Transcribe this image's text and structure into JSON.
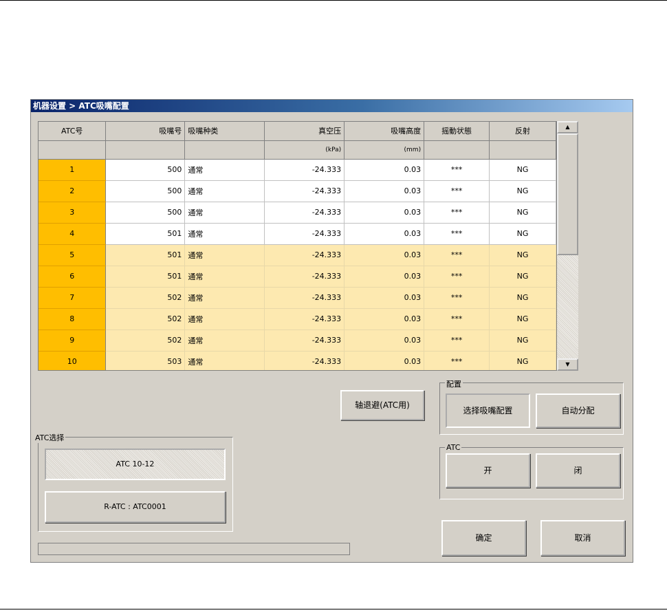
{
  "window": {
    "title": "机器设置 > ATC吸嘴配置"
  },
  "table": {
    "headers": [
      "ATC号",
      "吸嘴号",
      "吸嘴种类",
      "真空压",
      "吸嘴高度",
      "摇動状態",
      "反射"
    ],
    "units": [
      "",
      "",
      "",
      "(kPa)",
      "(mm)",
      "",
      ""
    ],
    "rows": [
      {
        "atc": "1",
        "nozzle": "500",
        "type": "通常",
        "vacuum": "-24.333",
        "height": "0.03",
        "state": "***",
        "reflect": "NG"
      },
      {
        "atc": "2",
        "nozzle": "500",
        "type": "通常",
        "vacuum": "-24.333",
        "height": "0.03",
        "state": "***",
        "reflect": "NG"
      },
      {
        "atc": "3",
        "nozzle": "500",
        "type": "通常",
        "vacuum": "-24.333",
        "height": "0.03",
        "state": "***",
        "reflect": "NG"
      },
      {
        "atc": "4",
        "nozzle": "501",
        "type": "通常",
        "vacuum": "-24.333",
        "height": "0.03",
        "state": "***",
        "reflect": "NG"
      },
      {
        "atc": "5",
        "nozzle": "501",
        "type": "通常",
        "vacuum": "-24.333",
        "height": "0.03",
        "state": "***",
        "reflect": "NG"
      },
      {
        "atc": "6",
        "nozzle": "501",
        "type": "通常",
        "vacuum": "-24.333",
        "height": "0.03",
        "state": "***",
        "reflect": "NG"
      },
      {
        "atc": "7",
        "nozzle": "502",
        "type": "通常",
        "vacuum": "-24.333",
        "height": "0.03",
        "state": "***",
        "reflect": "NG"
      },
      {
        "atc": "8",
        "nozzle": "502",
        "type": "通常",
        "vacuum": "-24.333",
        "height": "0.03",
        "state": "***",
        "reflect": "NG"
      },
      {
        "atc": "9",
        "nozzle": "502",
        "type": "通常",
        "vacuum": "-24.333",
        "height": "0.03",
        "state": "***",
        "reflect": "NG"
      },
      {
        "atc": "10",
        "nozzle": "503",
        "type": "通常",
        "vacuum": "-24.333",
        "height": "0.03",
        "state": "***",
        "reflect": "NG"
      }
    ]
  },
  "scroll": {
    "up": "▲",
    "down": "▼"
  },
  "axis_retreat_label": "轴退避(ATC用)",
  "atc_select": {
    "group_label": "ATC选择",
    "atc_range": "ATC 10-12",
    "ratc": "R-ATC : ATC0001"
  },
  "config": {
    "group_label": "配置",
    "select_nozzle": "选择吸嘴配置",
    "auto_assign": "自动分配"
  },
  "atc": {
    "group_label": "ATC",
    "open": "开",
    "close": "闭"
  },
  "footer": {
    "ok": "确定",
    "cancel": "取消"
  },
  "colors": {
    "atc_cell": "#ffbe00",
    "row_highlight": "#fde9b0",
    "title_bar": "#0a246a",
    "dialog_bg": "#d4d0c8"
  }
}
